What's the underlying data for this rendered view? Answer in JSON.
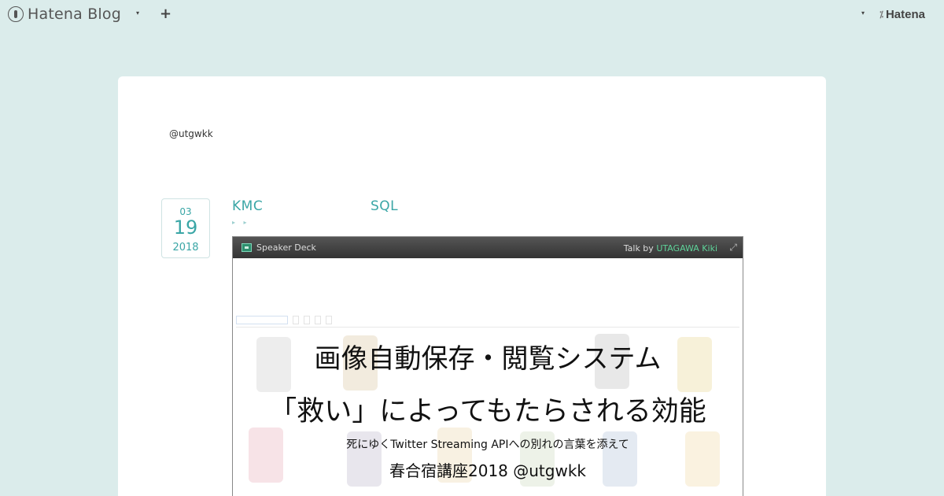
{
  "topbar": {
    "brand_label": "Hatena Blog",
    "plus_label": "+",
    "caret": "▾",
    "hatena_label": "Hatena",
    "hatena_mark": "⁒"
  },
  "blog": {
    "author_handle": "@utgwkk"
  },
  "post": {
    "date": {
      "month": "03",
      "day": "19",
      "year": "2018"
    },
    "title_left": "KMC",
    "title_right": "SQL",
    "breadcrumb": "▸ ▸"
  },
  "embed": {
    "provider": "Speaker Deck",
    "talk_prefix": "Talk by ",
    "talk_author": "UTAGAWA Kiki",
    "expand_icon": "⤢",
    "slide": {
      "line1": "画像自動保存・閲覧システム",
      "line2": "「救い」によってもたらされる効能",
      "line3": "死にゆくTwitter Streaming APIへの別れの言葉を添えて",
      "line4": "春合宿講座2018 @utgwkk"
    }
  },
  "colors": {
    "background": "#dbeceb",
    "accent": "#3aa6a6",
    "speakerdeck_author": "#5fd39a"
  }
}
